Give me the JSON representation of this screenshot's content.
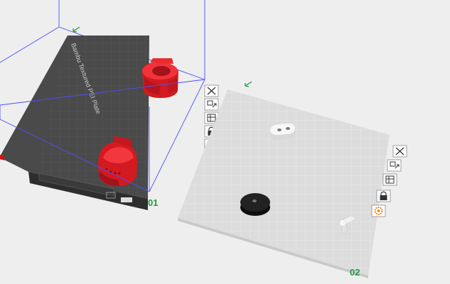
{
  "plates": [
    {
      "number": "01",
      "label": "Bambu Textured PEI Plate",
      "surface": "textured-pei",
      "objects": [
        "red-cylinder-part",
        "red-dome-part"
      ]
    },
    {
      "number": "02",
      "label": "",
      "surface": "smooth",
      "objects": [
        "white-bracket-part",
        "black-ring-part",
        "white-tee-part"
      ]
    }
  ],
  "plate_toolbar": {
    "icons": [
      "close-icon",
      "arrange-icon",
      "orient-icon",
      "lock-icon",
      "settings-gear-icon"
    ]
  },
  "colors": {
    "background": "#eeeeee",
    "plate1_surface": "#4a4a4a",
    "plate2_surface": "#dcdcdc",
    "bounding_box": "#4d4dff",
    "part_red": "#e01b22",
    "part_white": "#f2f2f2",
    "part_black": "#1a1a1a",
    "plate_number": "#1e9c3e",
    "accent": "#f07d00"
  }
}
